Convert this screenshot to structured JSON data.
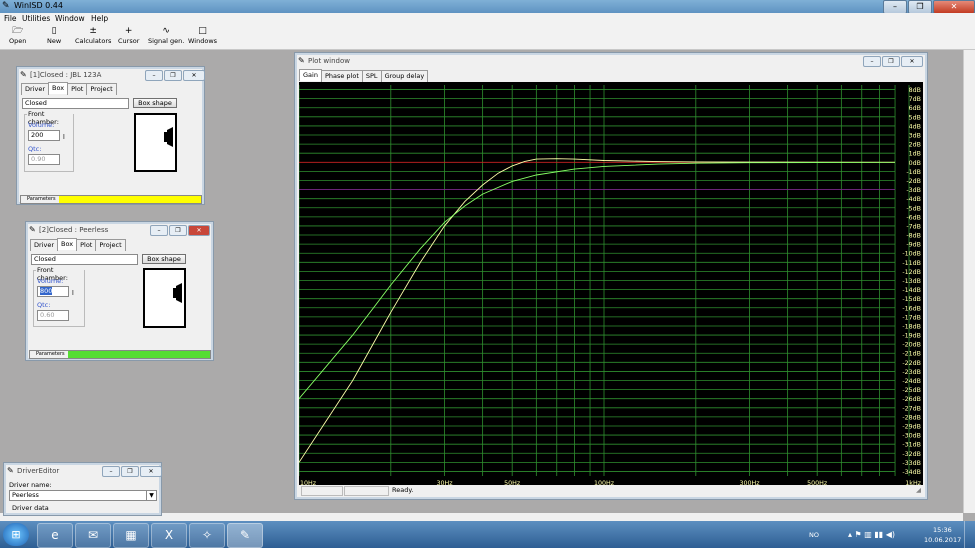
{
  "app": {
    "title": "WinISD 0.44",
    "icon": "winisd-icon"
  },
  "titlebar_buttons": [
    "minimize",
    "maximize",
    "close"
  ],
  "menu": [
    "File",
    "Utilities",
    "Window",
    "Help"
  ],
  "toolbar": [
    {
      "label": "Open",
      "icon": "folder-open-icon"
    },
    {
      "label": "New",
      "icon": "new-document-icon"
    },
    {
      "label": "Calculators",
      "icon": "calculator-icon"
    },
    {
      "label": "Cursor",
      "icon": "cursor-crosshair-icon"
    },
    {
      "label": "Signal gen.",
      "icon": "signal-generator-icon"
    },
    {
      "label": "Windows",
      "icon": "windows-icon"
    }
  ],
  "project1": {
    "title": "[1]Closed : JBL 123A",
    "tabs": [
      "Driver",
      "Box",
      "Plot",
      "Project"
    ],
    "active_tab": "Box",
    "box_type": "Closed",
    "box_shape_button": "Box shape",
    "group_label": "Front chamber:",
    "volume_label": "Volume:",
    "volume_value": "200",
    "unit": "l",
    "qtc_label": "Qtc:",
    "qtc_value": "0.90",
    "status_label": "Parameters",
    "status_color": "#ffff00"
  },
  "project2": {
    "title": "[2]Closed : Peerless",
    "tabs": [
      "Driver",
      "Box",
      "Plot",
      "Project"
    ],
    "active_tab": "Box",
    "box_type": "Closed",
    "box_shape_button": "Box shape",
    "group_label": "Front chamber:",
    "volume_label": "Volume:",
    "volume_value": "800",
    "unit": "l",
    "qtc_label": "Qtc:",
    "qtc_value": "0.60",
    "status_label": "Parameters",
    "status_color": "#55dd33"
  },
  "driver_editor": {
    "title": "DriverEditor",
    "name_label": "Driver name:",
    "name_value": "Peerless",
    "data_label": "Driver data"
  },
  "plot_window": {
    "title": "Plot window",
    "tabs": [
      "Gain",
      "Phase plot",
      "SPL",
      "Group delay"
    ],
    "active_tab": "Gain",
    "status": "Ready.",
    "x_labels": [
      {
        "f": 10,
        "t": "10Hz"
      },
      {
        "f": 30,
        "t": "30Hz"
      },
      {
        "f": 50,
        "t": "50Hz"
      },
      {
        "f": 100,
        "t": "100Hz"
      },
      {
        "f": 300,
        "t": "300Hz"
      },
      {
        "f": 500,
        "t": "500Hz"
      },
      {
        "f": 1000,
        "t": "1kHz"
      }
    ],
    "y_labels": [
      "8dB",
      "7dB",
      "6dB",
      "5dB",
      "4dB",
      "3dB",
      "2dB",
      "1dB",
      "0dB",
      "-1dB",
      "-2dB",
      "-3dB",
      "-4dB",
      "-5dB",
      "-6dB",
      "-7dB",
      "-8dB",
      "-9dB",
      "-10dB",
      "-11dB",
      "-12dB",
      "-13dB",
      "-14dB",
      "-15dB",
      "-16dB",
      "-17dB",
      "-18dB",
      "-19dB",
      "-20dB",
      "-21dB",
      "-22dB",
      "-23dB",
      "-24dB",
      "-25dB",
      "-26dB",
      "-27dB",
      "-28dB",
      "-29dB",
      "-30dB",
      "-31dB",
      "-32dB",
      "-33dB",
      "-34dB"
    ]
  },
  "chart_data": {
    "type": "line",
    "xlabel": "",
    "ylabel": "",
    "xscale": "log",
    "xlim": [
      10,
      1000
    ],
    "ylim": [
      -34.5,
      8.5
    ],
    "grid": true,
    "colors": {
      "background": "#000000",
      "grid": "#2f8f2f",
      "zero_line": "#cc2222",
      "minus3_line": "#7a2a8a",
      "label": "#ffff66"
    },
    "series": [
      {
        "color": "#ffffaa",
        "points": [
          [
            10,
            -33
          ],
          [
            15,
            -24
          ],
          [
            20,
            -16.5
          ],
          [
            25,
            -11
          ],
          [
            30,
            -7
          ],
          [
            35,
            -4.3
          ],
          [
            40,
            -2.5
          ],
          [
            45,
            -1.2
          ],
          [
            50,
            -0.4
          ],
          [
            55,
            0.1
          ],
          [
            60,
            0.35
          ],
          [
            70,
            0.4
          ],
          [
            80,
            0.35
          ],
          [
            100,
            0.2
          ],
          [
            150,
            0.08
          ],
          [
            200,
            0.04
          ],
          [
            300,
            0.02
          ],
          [
            500,
            0.01
          ],
          [
            900,
            0
          ]
        ]
      },
      {
        "color": "#88ff66",
        "points": [
          [
            10,
            -26
          ],
          [
            15,
            -19
          ],
          [
            20,
            -13.5
          ],
          [
            25,
            -9.5
          ],
          [
            30,
            -6.6
          ],
          [
            35,
            -4.8
          ],
          [
            40,
            -3.5
          ],
          [
            50,
            -2.1
          ],
          [
            60,
            -1.4
          ],
          [
            80,
            -0.75
          ],
          [
            100,
            -0.45
          ],
          [
            150,
            -0.2
          ],
          [
            200,
            -0.1
          ],
          [
            300,
            -0.05
          ],
          [
            500,
            -0.02
          ],
          [
            900,
            0
          ]
        ]
      }
    ]
  },
  "taskbar": {
    "items": [
      "start-orb-icon",
      "internet-explorer-icon",
      "outlook-icon",
      "project-icon",
      "excel-icon",
      "tools-icon",
      "winisd-icon"
    ],
    "lang": "NO",
    "time": "15:36",
    "date": "10.06.2017"
  }
}
